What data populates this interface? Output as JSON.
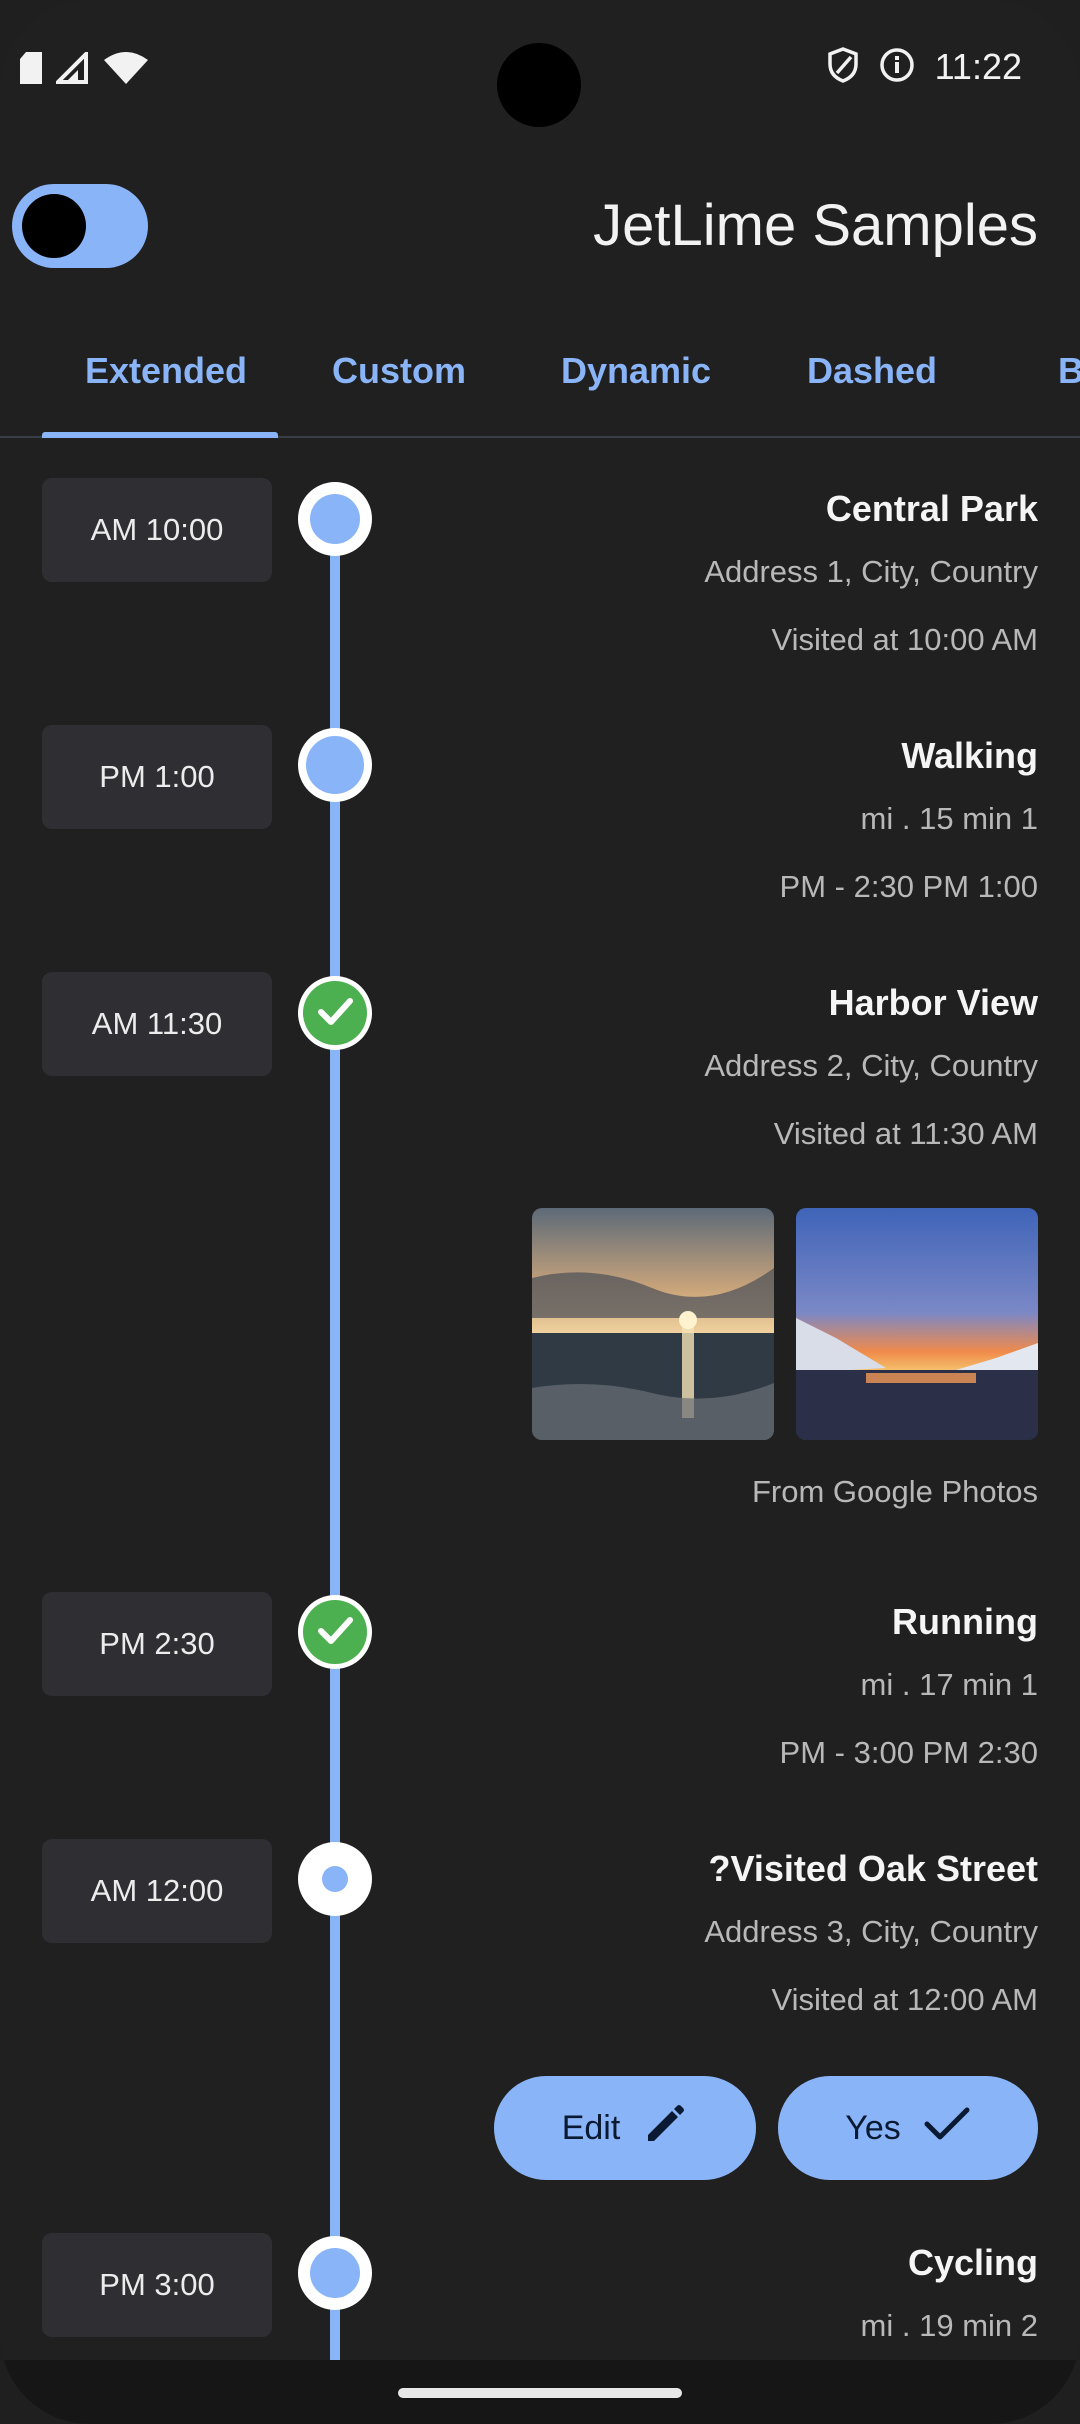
{
  "status_bar": {
    "time": "11:22",
    "icons": [
      "sim-icon",
      "signal-icon",
      "wifi-icon",
      "vpn-shield-icon",
      "info-icon"
    ]
  },
  "app_bar": {
    "title": "JetLime Samples",
    "theme_toggle": "dark"
  },
  "tabs": [
    {
      "label": "Extended",
      "selected": true
    },
    {
      "label": "Custom"
    },
    {
      "label": "Dynamic"
    },
    {
      "label": "Dashed"
    },
    {
      "label": "B"
    }
  ],
  "timeline": [
    {
      "time": "AM 10:00",
      "title": "Central Park",
      "line1": "Address 1, City, Country",
      "line2": "Visited at 10:00 AM",
      "node": "ring"
    },
    {
      "time": "PM 1:00",
      "title": "Walking",
      "line1": "mi . 15 min 1",
      "line2": "PM - 2:30 PM 1:00",
      "node": "ring-big"
    },
    {
      "time": "AM 11:30",
      "title": "Harbor View",
      "line1": "Address 2, City, Country",
      "line2": "Visited at 11:30 AM",
      "node": "check",
      "photos_caption": "From Google Photos"
    },
    {
      "time": "PM 2:30",
      "title": "Running",
      "line1": "mi . 17 min 1",
      "line2": "PM - 3:00 PM 2:30",
      "node": "check"
    },
    {
      "time": "AM 12:00",
      "title": "?Visited Oak Street",
      "line1": "Address 3, City, Country",
      "line2": "Visited at 12:00 AM",
      "node": "ring-small"
    },
    {
      "time": "PM 3:00",
      "title": "Cycling",
      "line1": "mi . 19 min 2",
      "node": "ring"
    }
  ],
  "actions": {
    "edit_label": "Edit",
    "yes_label": "Yes"
  },
  "colors": {
    "accent": "#8ab4f8",
    "check": "#4caf50",
    "background": "#202020",
    "chip": "#2f2f33"
  }
}
